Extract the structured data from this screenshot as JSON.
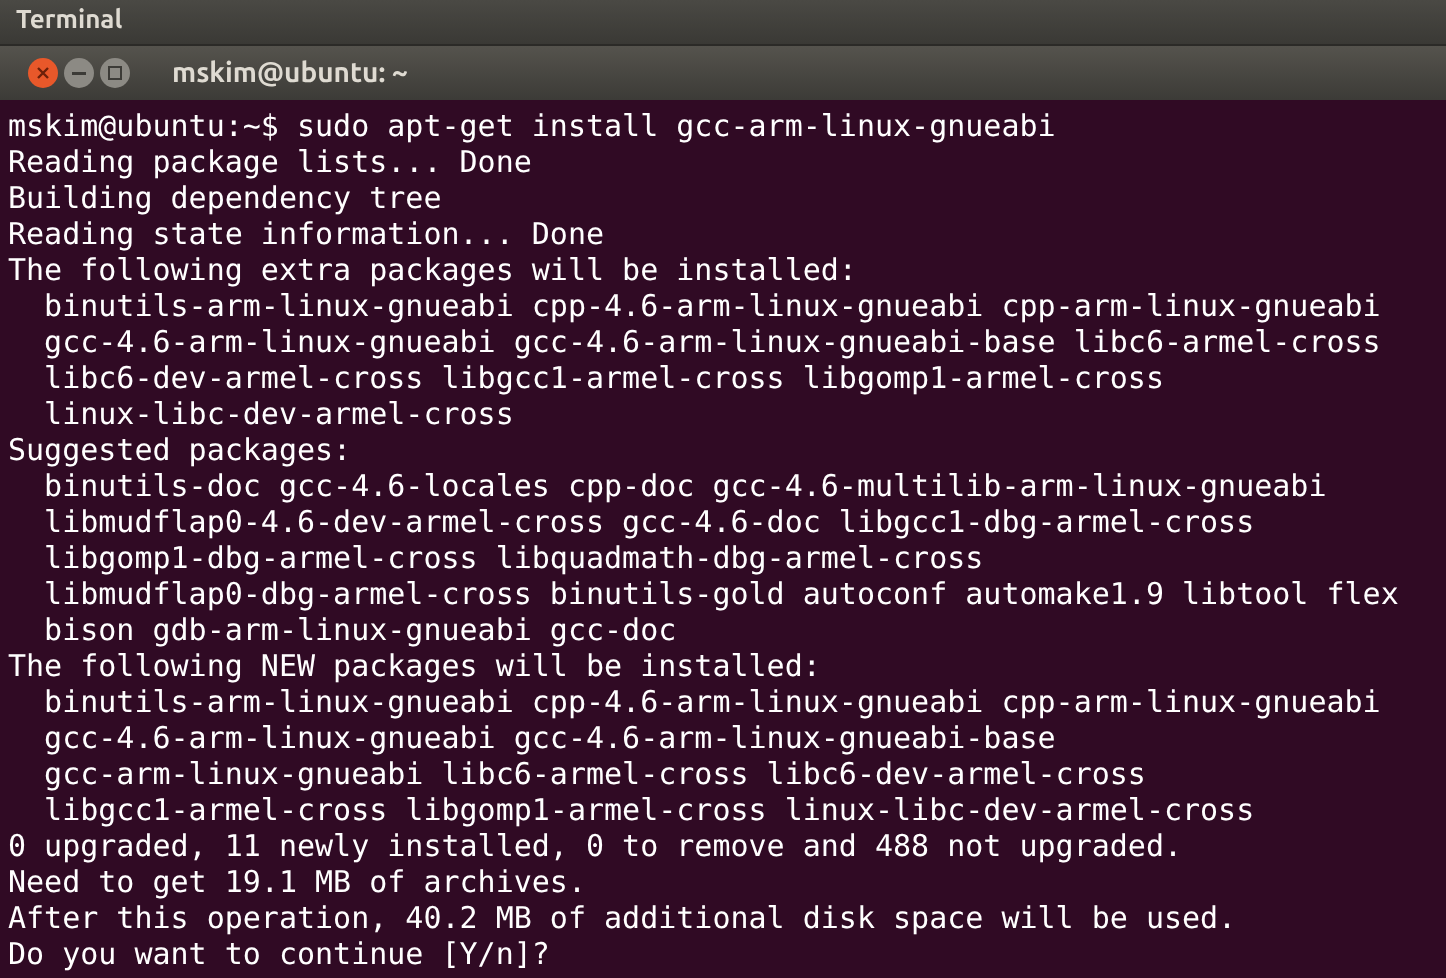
{
  "top_panel": {
    "title": "Terminal"
  },
  "window": {
    "title": "mskim@ubuntu: ~"
  },
  "terminal": {
    "lines": [
      "mskim@ubuntu:~$ sudo apt-get install gcc-arm-linux-gnueabi",
      "Reading package lists... Done",
      "Building dependency tree",
      "Reading state information... Done",
      "The following extra packages will be installed:",
      "  binutils-arm-linux-gnueabi cpp-4.6-arm-linux-gnueabi cpp-arm-linux-gnueabi",
      "  gcc-4.6-arm-linux-gnueabi gcc-4.6-arm-linux-gnueabi-base libc6-armel-cross",
      "  libc6-dev-armel-cross libgcc1-armel-cross libgomp1-armel-cross",
      "  linux-libc-dev-armel-cross",
      "Suggested packages:",
      "  binutils-doc gcc-4.6-locales cpp-doc gcc-4.6-multilib-arm-linux-gnueabi",
      "  libmudflap0-4.6-dev-armel-cross gcc-4.6-doc libgcc1-dbg-armel-cross",
      "  libgomp1-dbg-armel-cross libquadmath-dbg-armel-cross",
      "  libmudflap0-dbg-armel-cross binutils-gold autoconf automake1.9 libtool flex",
      "  bison gdb-arm-linux-gnueabi gcc-doc",
      "The following NEW packages will be installed:",
      "  binutils-arm-linux-gnueabi cpp-4.6-arm-linux-gnueabi cpp-arm-linux-gnueabi",
      "  gcc-4.6-arm-linux-gnueabi gcc-4.6-arm-linux-gnueabi-base",
      "  gcc-arm-linux-gnueabi libc6-armel-cross libc6-dev-armel-cross",
      "  libgcc1-armel-cross libgomp1-armel-cross linux-libc-dev-armel-cross",
      "0 upgraded, 11 newly installed, 0 to remove and 488 not upgraded.",
      "Need to get 19.1 MB of archives.",
      "After this operation, 40.2 MB of additional disk space will be used.",
      "Do you want to continue [Y/n]?"
    ]
  }
}
